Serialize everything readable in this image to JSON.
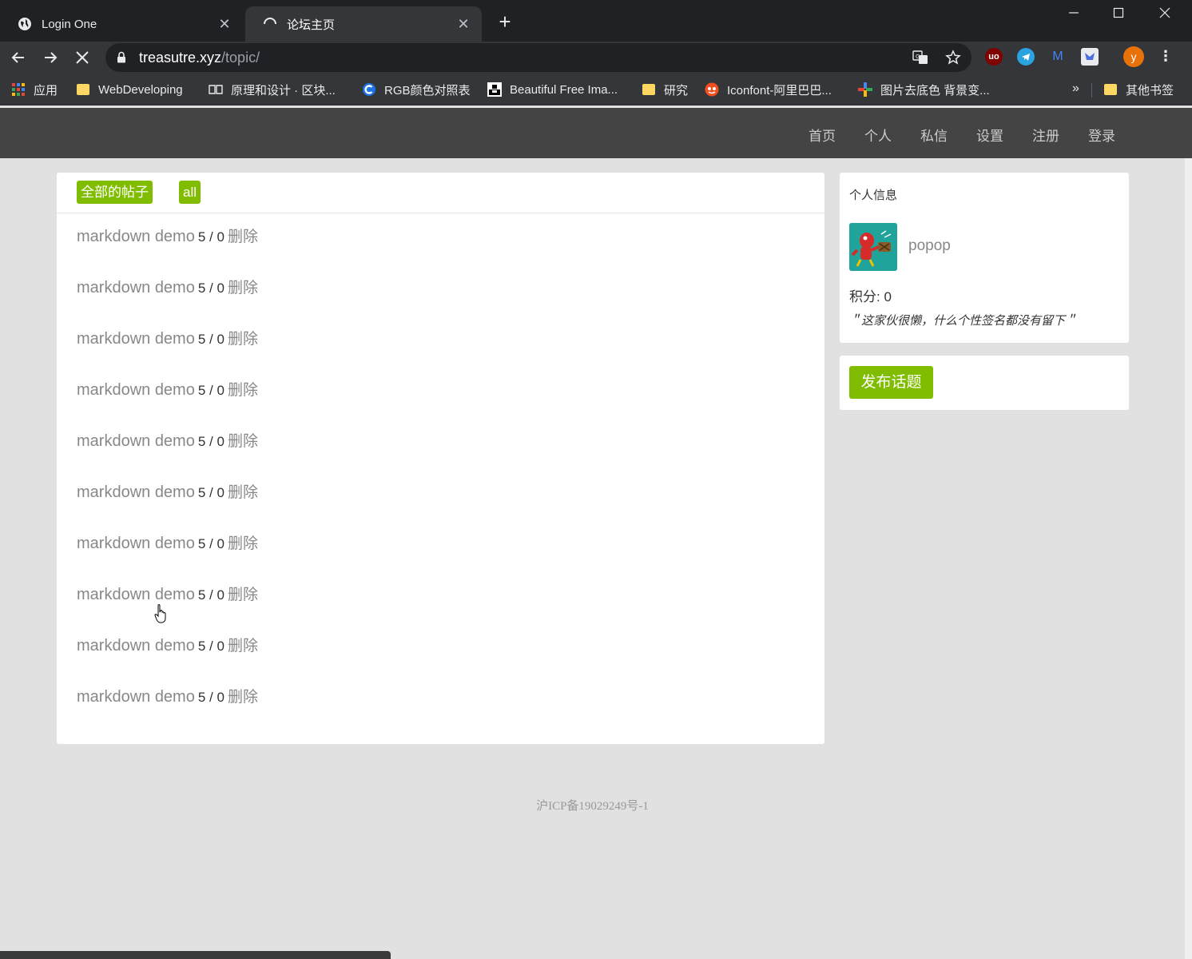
{
  "browser": {
    "tabs": [
      {
        "title": "Login One",
        "close": "✕"
      },
      {
        "title": "论坛主页",
        "close": "✕"
      }
    ],
    "new_tab": "+",
    "url_host": "treasutre.xyz",
    "url_path": "/topic/",
    "profile_initial": "y",
    "bookmarks": [
      {
        "label": "应用",
        "icon": "apps-grid-icon"
      },
      {
        "label": "WebDeveloping",
        "icon": "folder-icon"
      },
      {
        "label": "原理和设计 · 区块...",
        "icon": "book-icon"
      },
      {
        "label": "RGB颜色对照表",
        "icon": "c-logo-icon"
      },
      {
        "label": "Beautiful Free Ima...",
        "icon": "unsplash-icon"
      },
      {
        "label": "研究",
        "icon": "folder-icon"
      },
      {
        "label": "Iconfont-阿里巴巴...",
        "icon": "iconfont-icon"
      },
      {
        "label": "图片去底色 背景变...",
        "icon": "plus-color-icon"
      }
    ],
    "bookmarks_more": "»",
    "other_bookmarks": "其他书签"
  },
  "nav": {
    "items": [
      "首页",
      "个人",
      "私信",
      "设置",
      "注册",
      "登录"
    ]
  },
  "main": {
    "tags": [
      "全部的帖子",
      "all"
    ],
    "topics": [
      {
        "title": "markdown demo",
        "count": "5 / 0",
        "action": "删除"
      },
      {
        "title": "markdown demo",
        "count": "5 / 0",
        "action": "删除"
      },
      {
        "title": "markdown demo",
        "count": "5 / 0",
        "action": "删除"
      },
      {
        "title": "markdown demo",
        "count": "5 / 0",
        "action": "删除"
      },
      {
        "title": "markdown demo",
        "count": "5 / 0",
        "action": "删除"
      },
      {
        "title": "markdown demo",
        "count": "5 / 0",
        "action": "删除"
      },
      {
        "title": "markdown demo",
        "count": "5 / 0",
        "action": "删除"
      },
      {
        "title": "markdown demo",
        "count": "5 / 0",
        "action": "删除"
      },
      {
        "title": "markdown demo",
        "count": "5 / 0",
        "action": "删除"
      },
      {
        "title": "markdown demo",
        "count": "5 / 0",
        "action": "删除"
      }
    ]
  },
  "sidebar": {
    "profile_title": "个人信息",
    "username": "popop",
    "score": "积分: 0",
    "signature": "＂这家伙很懒，什么个性签名都没有留下＂",
    "publish_label": "发布话题"
  },
  "footer": {
    "icp": "沪ICP备19029249号-1"
  },
  "colors": {
    "accent": "#80bd01",
    "nav_bg": "#444444",
    "page_bg": "#e1e1e1"
  }
}
